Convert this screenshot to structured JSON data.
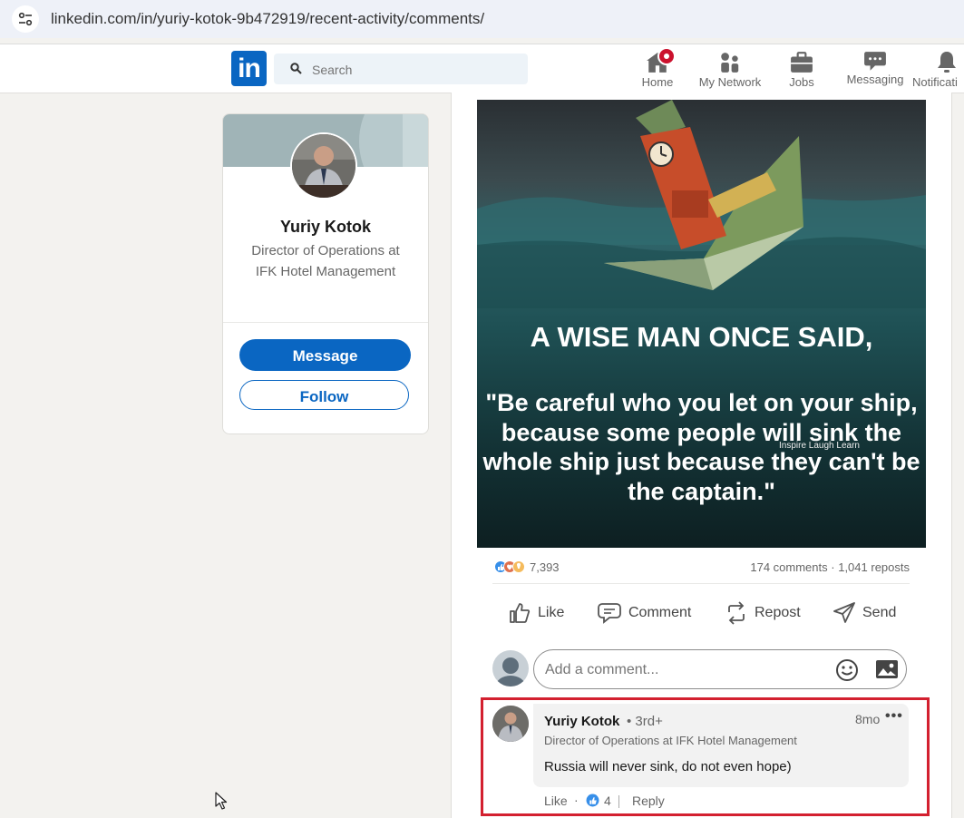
{
  "browser": {
    "url": "linkedin.com/in/yuriy-kotok-9b472919/recent-activity/comments/"
  },
  "nav": {
    "logo": "in",
    "search_placeholder": "Search",
    "items": [
      {
        "label": "Home",
        "icon": "home-icon"
      },
      {
        "label": "My Network",
        "icon": "network-icon"
      },
      {
        "label": "Jobs",
        "icon": "briefcase-icon"
      },
      {
        "label": "Messaging",
        "icon": "messaging-icon"
      },
      {
        "label": "Notificati",
        "icon": "bell-icon"
      }
    ],
    "accent": "#0a66c2",
    "badge_color": "#cb112d"
  },
  "profile": {
    "name": "Yuriy Kotok",
    "headline": "Director of Operations at IFK Hotel Management",
    "message_label": "Message",
    "follow_label": "Follow"
  },
  "post": {
    "image_text": {
      "heading": "A WISE MAN ONCE SAID,",
      "quote": "\"Be careful who you let on your ship, because some people will sink the whole ship just because they can't be the captain.\"",
      "watermark": "Inspire Laugh Learn"
    },
    "reactions_count": "7,393",
    "comments": "174 comments",
    "separator": "·",
    "reposts": "1,041 reposts",
    "actions": {
      "like": "Like",
      "comment": "Comment",
      "repost": "Repost",
      "send": "Send"
    },
    "add_comment_placeholder": "Add a comment..."
  },
  "comment": {
    "author": "Yuriy Kotok",
    "degree": "• 3rd+",
    "time": "8mo",
    "more": "•••",
    "headline": "Director of Operations at IFK Hotel Management",
    "text": "Russia will never sink, do not even hope)",
    "like_label": "Like",
    "dot": "·",
    "reaction_count": "4",
    "reply_label": "Reply",
    "highlight_color": "#d3202f"
  }
}
